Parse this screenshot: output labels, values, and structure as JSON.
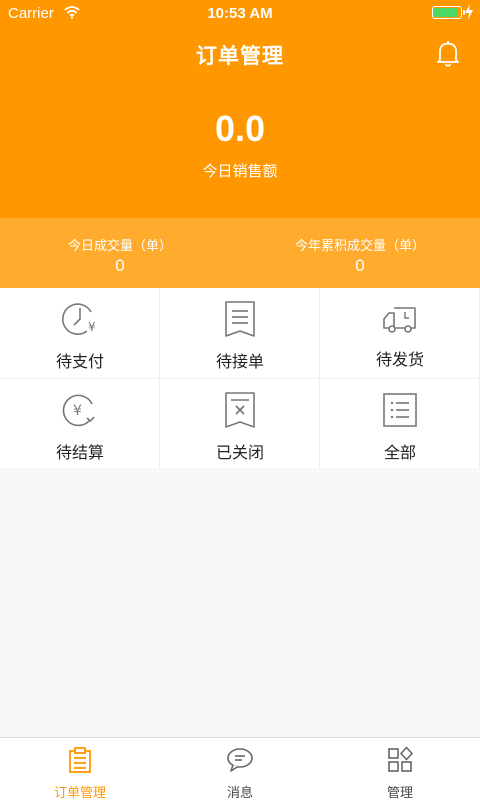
{
  "status_bar": {
    "carrier": "Carrier",
    "time": "10:53 AM"
  },
  "header": {
    "title": "订单管理",
    "sales_amount": "0.0",
    "sales_label": "今日销售额"
  },
  "stats": {
    "today_label": "今日成交量（单）",
    "today_value": "0",
    "year_label": "今年累积成交量（单）",
    "year_value": "0"
  },
  "grid": [
    {
      "label": "待支付",
      "icon": "clock-yen-icon"
    },
    {
      "label": "待接单",
      "icon": "receipt-list-icon"
    },
    {
      "label": "待发货",
      "icon": "delivery-truck-icon"
    },
    {
      "label": "待结算",
      "icon": "yen-refresh-icon"
    },
    {
      "label": "已关闭",
      "icon": "receipt-closed-icon"
    },
    {
      "label": "全部",
      "icon": "list-all-icon"
    }
  ],
  "tabbar": [
    {
      "label": "订单管理",
      "icon": "clipboard-icon",
      "active": true
    },
    {
      "label": "消息",
      "icon": "chat-bubble-icon",
      "active": false
    },
    {
      "label": "管理",
      "icon": "apps-grid-icon",
      "active": false
    }
  ],
  "colors": {
    "primary": "#ff9800",
    "stats_strip": "#ffab2e",
    "battery": "#4cd964"
  }
}
